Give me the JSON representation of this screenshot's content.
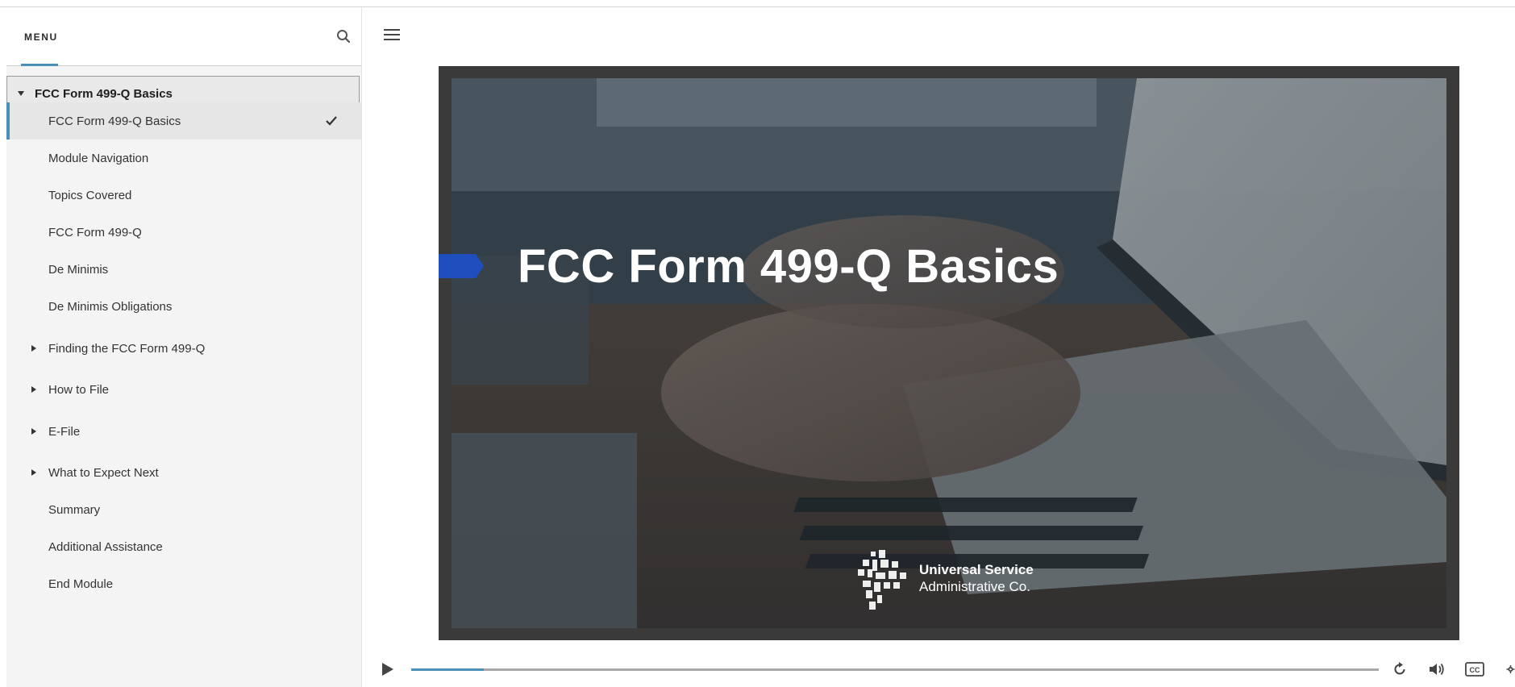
{
  "sidebar": {
    "title": "MENU",
    "section": {
      "label": "FCC Form 499-Q Basics"
    },
    "items": [
      {
        "label": "FCC Form 499-Q Basics",
        "active": true,
        "completed": true,
        "expandable": false
      },
      {
        "label": "Module Navigation",
        "active": false,
        "completed": false,
        "expandable": false
      },
      {
        "label": "Topics Covered",
        "active": false,
        "completed": false,
        "expandable": false
      },
      {
        "label": "FCC Form 499-Q",
        "active": false,
        "completed": false,
        "expandable": false
      },
      {
        "label": "De Minimis",
        "active": false,
        "completed": false,
        "expandable": false
      },
      {
        "label": "De Minimis Obligations",
        "active": false,
        "completed": false,
        "expandable": false
      },
      {
        "label": "Finding the FCC Form 499-Q",
        "active": false,
        "completed": false,
        "expandable": true
      },
      {
        "label": "How to File",
        "active": false,
        "completed": false,
        "expandable": true
      },
      {
        "label": "E-File",
        "active": false,
        "completed": false,
        "expandable": true
      },
      {
        "label": "What to Expect Next",
        "active": false,
        "completed": false,
        "expandable": true
      },
      {
        "label": "Summary",
        "active": false,
        "completed": false,
        "expandable": false
      },
      {
        "label": "Additional Assistance",
        "active": false,
        "completed": false,
        "expandable": false
      },
      {
        "label": "End Module",
        "active": false,
        "completed": false,
        "expandable": false
      }
    ]
  },
  "slide": {
    "title": "FCC Form 499-Q Basics",
    "logo_line1": "Universal Service",
    "logo_line2": "Administrative Co."
  },
  "player": {
    "progress_fraction": 0.075
  },
  "colors": {
    "accent": "#4a90b8",
    "title_marker": "#1f4fbf"
  },
  "icons": [
    "search-icon",
    "hamburger-icon",
    "caret-down-icon",
    "caret-right-icon",
    "check-icon",
    "play-icon",
    "replay-icon",
    "volume-icon",
    "closed-captions-icon",
    "settings-icon"
  ]
}
